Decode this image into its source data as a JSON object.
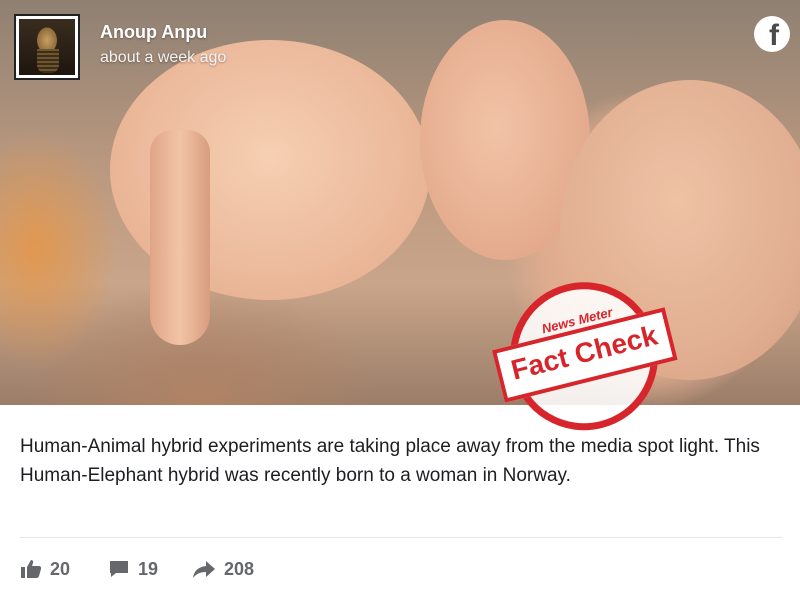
{
  "post": {
    "author": "Anoup Anpu",
    "timestamp": "about a week ago",
    "platform_icon": "facebook-icon",
    "caption": "Human-Animal hybrid experiments are taking place away from the media spot light. This Human-Elephant hybrid was recently born to a woman in Norway."
  },
  "stamp": {
    "brand": "News Meter",
    "label": "Fact Check",
    "color": "#d7262b"
  },
  "reactions": {
    "likes": "20",
    "comments": "19",
    "shares": "208"
  },
  "icons": {
    "like": "thumbs-up-icon",
    "comment": "comment-icon",
    "share": "share-arrow-icon"
  }
}
